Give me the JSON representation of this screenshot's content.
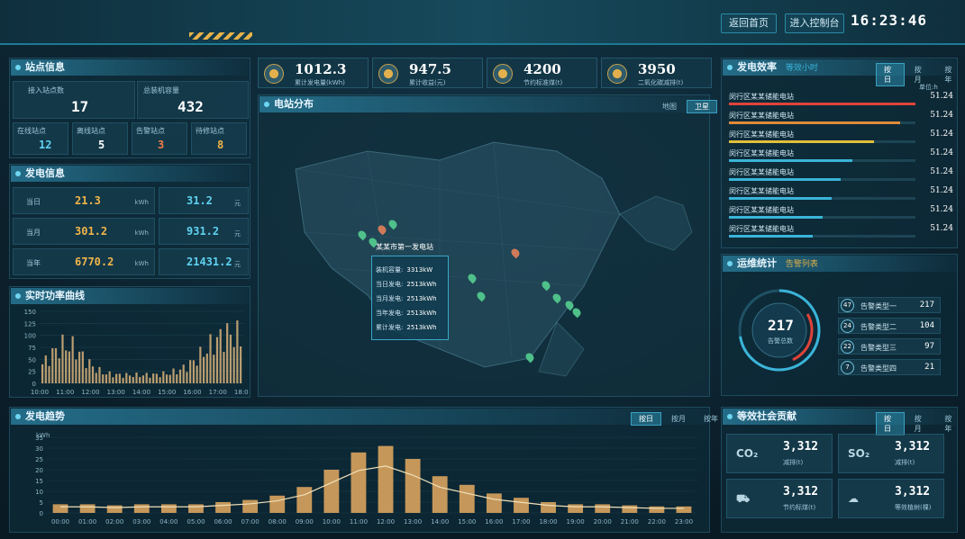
{
  "header": {
    "back_home": "返回首页",
    "enter_console": "进入控制台",
    "clock": "16:23:46"
  },
  "site_info": {
    "title": "站点信息",
    "installed_label": "接入站点数",
    "installed_value": "17",
    "capacity_label": "总装机容量",
    "capacity_value": "432",
    "stats": [
      {
        "label": "在线站点",
        "value": "12",
        "color": "#5fd2f0"
      },
      {
        "label": "离线站点",
        "value": "5",
        "color": "#ffffff"
      },
      {
        "label": "告警站点",
        "value": "3",
        "color": "#f07b4a"
      },
      {
        "label": "待修站点",
        "value": "8",
        "color": "#f0b54a"
      }
    ]
  },
  "gen_info": {
    "title": "发电信息",
    "rows": [
      {
        "label": "当日",
        "v1": "21.3",
        "u1": "kWh",
        "v2": "31.2",
        "u2": "元"
      },
      {
        "label": "当月",
        "v1": "301.2",
        "u1": "kWh",
        "v2": "931.2",
        "u2": "元"
      },
      {
        "label": "当年",
        "v1": "6770.2",
        "u1": "kWh",
        "v2": "21431.2",
        "u2": "元"
      }
    ]
  },
  "power_curve": {
    "title": "实时功率曲线",
    "xticks": [
      "10:00",
      "11:00",
      "12:00",
      "13:00",
      "14:00",
      "15:00",
      "16:00",
      "17:00",
      "18:00"
    ],
    "yticks": [
      "150",
      "125",
      "100",
      "75",
      "50",
      "25",
      "0"
    ]
  },
  "chart_data": {
    "type": "bar",
    "title": "发电趋势",
    "categories": [
      "00:00",
      "01:00",
      "02:00",
      "03:00",
      "04:00",
      "05:00",
      "06:00",
      "07:00",
      "08:00",
      "09:00",
      "10:00",
      "11:00",
      "12:00",
      "13:00",
      "14:00",
      "15:00",
      "16:00",
      "17:00",
      "18:00",
      "19:00",
      "20:00",
      "21:00",
      "22:00",
      "23:00"
    ],
    "series": [
      {
        "name": "",
        "values": [
          4,
          4,
          3.5,
          4,
          4,
          4,
          5,
          6,
          8,
          12,
          20,
          28,
          31,
          25,
          17,
          13,
          9,
          7,
          5,
          4,
          4,
          3.5,
          3,
          3
        ]
      }
    ],
    "ylim": [
      0,
      35
    ],
    "yticks": [
      "35",
      "30",
      "25",
      "20",
      "15",
      "10",
      "5",
      "0"
    ],
    "ylabel": "kWh",
    "grid": true
  },
  "gen_trend": {
    "title": "发电趋势",
    "tabs": [
      "按日",
      "按月",
      "按年"
    ],
    "ylabel": "kWh"
  },
  "kpis": [
    {
      "value": "1012.3",
      "label": "累计发电量(kWh)"
    },
    {
      "value": "947.5",
      "label": "累计收益(元)"
    },
    {
      "value": "4200",
      "label": "节约标准煤(t)"
    },
    {
      "value": "3950",
      "label": "二氧化碳减排(t)"
    }
  ],
  "map": {
    "title": "电站分布",
    "tabs": [
      "地图",
      "卫星"
    ],
    "tooltip": {
      "title": "某某市第一发电站",
      "rows": [
        {
          "k": "装机容量:",
          "v": "3313kW"
        },
        {
          "k": "当日发电:",
          "v": "2513kWh"
        },
        {
          "k": "当月发电:",
          "v": "2513kWh"
        },
        {
          "k": "当年发电:",
          "v": "2513kWh"
        },
        {
          "k": "累计发电:",
          "v": "2513kWh"
        }
      ]
    }
  },
  "efficiency": {
    "title": "发电效率",
    "subtitle": "等效小时",
    "tabs": [
      "按日",
      "按月",
      "按年"
    ],
    "unit": "单位:h",
    "rows": [
      {
        "name": "闵行区某某储能电站",
        "value": "51.24",
        "pct": 1.0,
        "color": "#e0433a"
      },
      {
        "name": "闵行区某某储能电站",
        "value": "51.24",
        "pct": 0.92,
        "color": "#e08a3a"
      },
      {
        "name": "闵行区某某储能电站",
        "value": "51.24",
        "pct": 0.78,
        "color": "#e0c03a"
      },
      {
        "name": "闵行区某某储能电站",
        "value": "51.24",
        "pct": 0.66,
        "color": "#3ab4d8"
      },
      {
        "name": "闵行区某某储能电站",
        "value": "51.24",
        "pct": 0.6,
        "color": "#3ab4d8"
      },
      {
        "name": "闵行区某某储能电站",
        "value": "51.24",
        "pct": 0.55,
        "color": "#3ab4d8"
      },
      {
        "name": "闵行区某某储能电站",
        "value": "51.24",
        "pct": 0.5,
        "color": "#3ab4d8"
      },
      {
        "name": "闵行区某某储能电站",
        "value": "51.24",
        "pct": 0.45,
        "color": "#3ab4d8"
      }
    ]
  },
  "maintenance": {
    "title": "运维统计",
    "subtitle": "告警列表",
    "total": "217",
    "total_label": "告警总数",
    "rows": [
      {
        "badge": "47",
        "label": "告警类型一",
        "value": "217"
      },
      {
        "badge": "24",
        "label": "告警类型二",
        "value": "104"
      },
      {
        "badge": "22",
        "label": "告警类型三",
        "value": "97"
      },
      {
        "badge": "7",
        "label": "告警类型四",
        "value": "21"
      }
    ]
  },
  "social": {
    "title": "等效社会贡献",
    "tabs": [
      "按日",
      "按月",
      "按年"
    ],
    "items": [
      {
        "icon": "CO₂",
        "value": "3,312",
        "label": "减排(t)"
      },
      {
        "icon": "SO₂",
        "value": "3,312",
        "label": "减排(t)"
      },
      {
        "icon": "truck",
        "value": "3,312",
        "label": "节约标煤(t)"
      },
      {
        "icon": "cloud",
        "value": "3,312",
        "label": "等效植树(棵)"
      }
    ]
  }
}
